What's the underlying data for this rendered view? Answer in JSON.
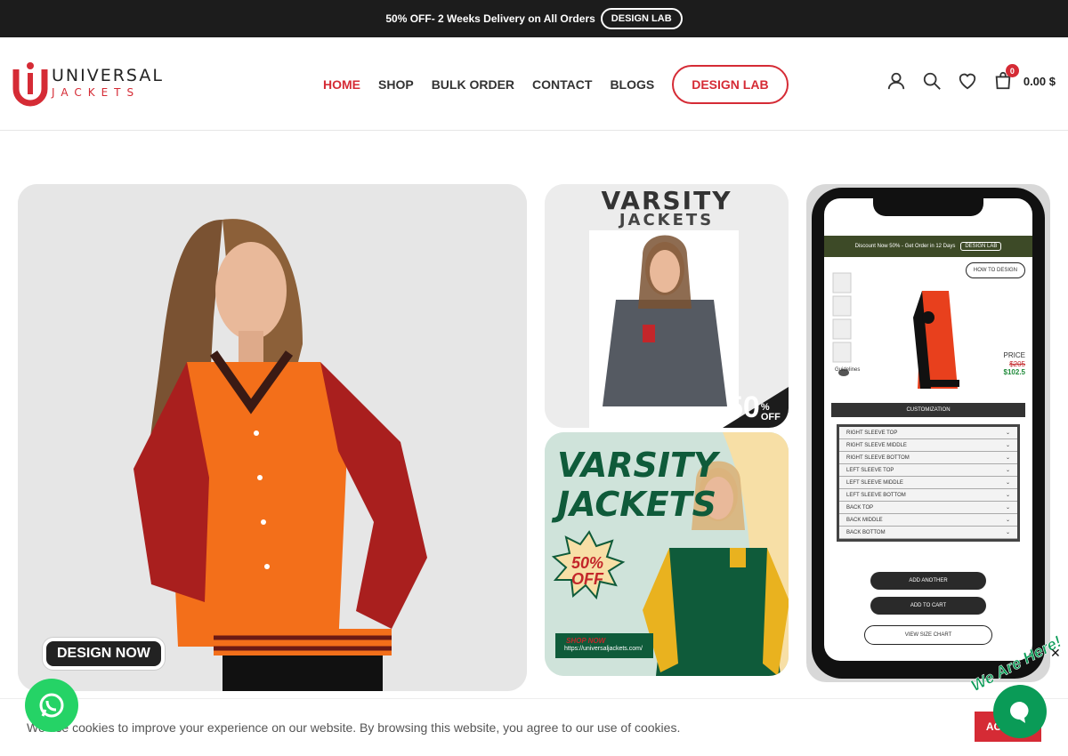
{
  "promo": {
    "text": "50% OFF- 2 Weeks Delivery on All Orders",
    "button": "DESIGN LAB"
  },
  "logo": {
    "line1": "UNIVERSAL",
    "line2": "JACKETS"
  },
  "nav": {
    "items": [
      "HOME",
      "SHOP",
      "BULK ORDER",
      "CONTACT",
      "BLOGS"
    ],
    "design_lab": "DESIGN LAB"
  },
  "cart": {
    "count": "0",
    "total": "0.00 $"
  },
  "hero": {
    "button": "DESIGN NOW"
  },
  "tile1": {
    "title1": "VARSITY",
    "title2": "JACKETS",
    "badge_num": "50",
    "badge_pct": "%",
    "badge_off": "OFF"
  },
  "tile2": {
    "title1": "VARSITY",
    "title2": "JACKETS",
    "burst1": "50%",
    "burst2": "OFF",
    "shop_now": "SHOP NOW",
    "url": "https://universaljackets.com/"
  },
  "phone": {
    "banner": "Discount Now 50% - Get Order in 12 Days",
    "banner_button": "DESIGN LAB",
    "how_to": "HOW TO DESIGN",
    "price_label": "PRICE",
    "old_price": "$205",
    "new_price": "$102.5",
    "guidelines": "Guidelines",
    "customization": "CUSTOMIZATION",
    "rows": [
      "RIGHT SLEEVE TOP",
      "RIGHT SLEEVE MIDDLE",
      "RIGHT SLEEVE BOTTOM",
      "LEFT SLEEVE TOP",
      "LEFT SLEEVE MIDDLE",
      "LEFT SLEEVE BOTTOM",
      "BACK TOP",
      "BACK MIDDLE",
      "BACK BOTTOM"
    ],
    "add_another": "ADD ANOTHER",
    "add_to_cart": "ADD TO CART",
    "size_chart": "VIEW SIZE CHART"
  },
  "cookie": {
    "text": "We use cookies to improve your experience on our website. By browsing this website, you agree to our use of cookies.",
    "accept": "ACCEPT"
  },
  "chat": {
    "label": "We Are Here!"
  },
  "colors": {
    "brand": "#d52b35",
    "dark": "#1c1c1c",
    "whatsapp": "#25d366",
    "chat": "#0a9b57"
  }
}
